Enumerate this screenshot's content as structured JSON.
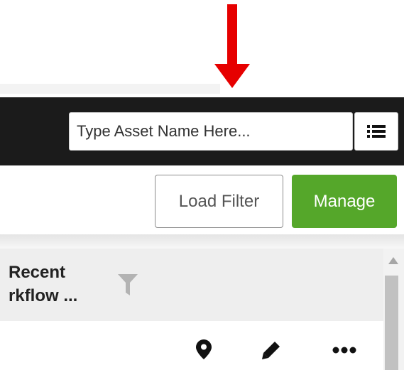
{
  "header": {
    "search": {
      "value": "",
      "placeholder": "Type Asset Name Here..."
    },
    "list_button_icon": "list-icon"
  },
  "toolbar": {
    "load_filter_label": "Load Filter",
    "manage_label": "Manage"
  },
  "table": {
    "column_title": "Recent\nrkflow ...",
    "column_filter_icon": "filter-icon",
    "row_actions": [
      "map-pin-icon",
      "pencil-icon",
      "more-horizontal-icon"
    ]
  },
  "annotation": {
    "arrow_color": "#e60000"
  },
  "colors": {
    "header_bg": "#1b1b1b",
    "manage_bg": "#55a72a",
    "table_header_bg": "#eeeeee"
  }
}
